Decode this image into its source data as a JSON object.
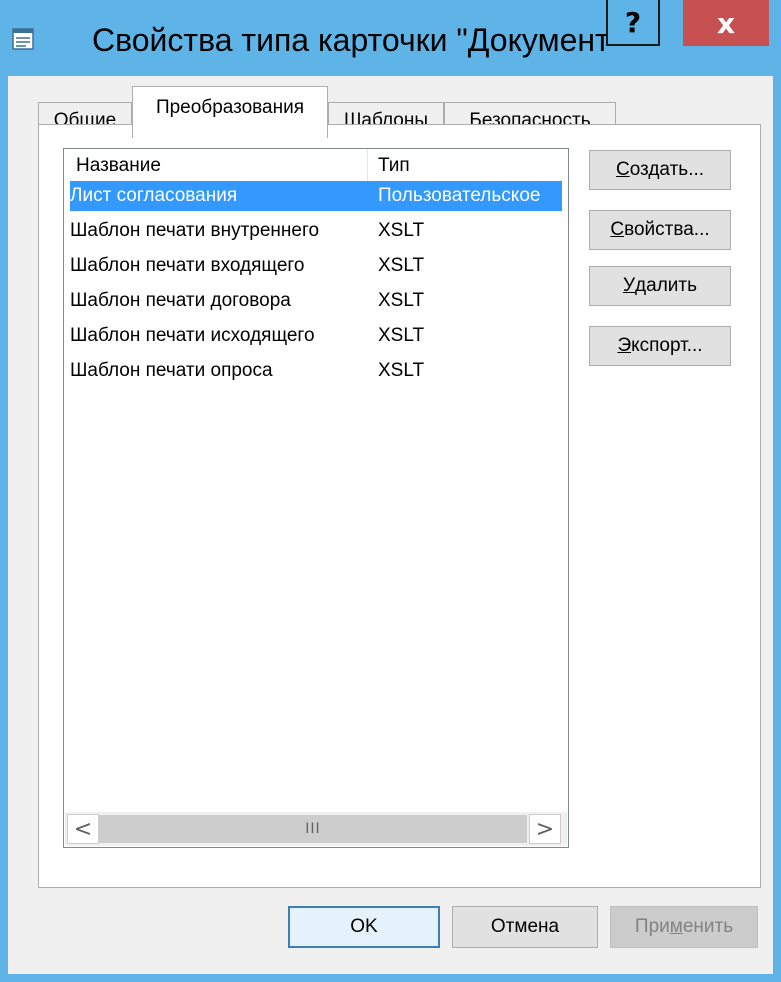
{
  "window": {
    "title": "Свойства типа карточки \"Документ\"",
    "help_label": "?",
    "close_label": "x"
  },
  "tabs": [
    {
      "label": "Общие",
      "active": false
    },
    {
      "label": "Преобразования",
      "active": true
    },
    {
      "label": "Шаблоны",
      "active": false
    },
    {
      "label": "Безопасность",
      "active": false
    }
  ],
  "list": {
    "columns": [
      "Название",
      "Тип"
    ],
    "rows": [
      {
        "name": "Лист согласования",
        "type": "Пользовательское",
        "selected": true
      },
      {
        "name": "Шаблон печати внутреннего",
        "type": "XSLT",
        "selected": false
      },
      {
        "name": "Шаблон печати входящего",
        "type": "XSLT",
        "selected": false
      },
      {
        "name": "Шаблон печати договора",
        "type": "XSLT",
        "selected": false
      },
      {
        "name": "Шаблон печати исходящего",
        "type": "XSLT",
        "selected": false
      },
      {
        "name": "Шаблон печати опроса",
        "type": "XSLT",
        "selected": false
      }
    ],
    "scroll_left": "<",
    "scroll_right": ">",
    "scroll_thumb": "III"
  },
  "side_buttons": {
    "create": {
      "accel": "С",
      "rest": "оздать..."
    },
    "properties": {
      "accel": "С",
      "rest": "войства..."
    },
    "delete": {
      "accel": "У",
      "rest": "далить"
    },
    "export": {
      "accel": "Э",
      "rest": "кспорт..."
    }
  },
  "footer": {
    "ok": "OK",
    "cancel": "Отмена",
    "apply_pre": "При",
    "apply_accel": "м",
    "apply_post": "енить",
    "apply_disabled": true
  },
  "colors": {
    "titlebar": "#5eb4e6",
    "close": "#c75050",
    "selection": "#3399ff"
  }
}
